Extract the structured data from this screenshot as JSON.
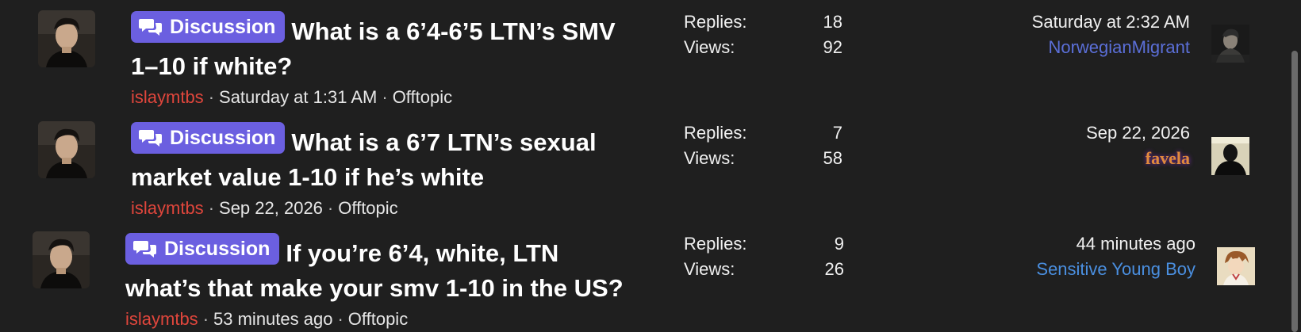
{
  "threads": [
    {
      "prefix": "Discussion",
      "title_line1": "What is a 6’4-6’5 LTN’s SMV",
      "title_line2": "1–10 if white?",
      "author": "islaymtbs",
      "started": "Saturday at 1:31 AM",
      "forum": "Offtopic",
      "replies_label": "Replies:",
      "replies": "18",
      "views_label": "Views:",
      "views": "92",
      "last_time": "Saturday at 2:32 AM",
      "last_user": "NorwegianMigrant",
      "last_user_color": "#5b6fd8",
      "last_avatar_icon": "dark-portrait-avatar"
    },
    {
      "prefix": "Discussion",
      "title_line1": "What is a 6’7 LTN’s sexual",
      "title_line2": "market value 1-10 if he’s white",
      "author": "islaymtbs",
      "started": "Sep 22, 2026",
      "forum": "Offtopic",
      "replies_label": "Replies:",
      "replies": "7",
      "views_label": "Views:",
      "views": "58",
      "last_time": "Sep 22, 2026",
      "last_user": "favela",
      "last_user_color": "#e08a3c",
      "last_avatar_icon": "silhouette-avatar"
    },
    {
      "prefix": "Discussion",
      "title_line1": "If you’re 6’4, white, LTN",
      "title_line2": "what’s that make your smv 1-10 in the US?",
      "author": "islaymtbs",
      "started": "53 minutes ago",
      "forum": "Offtopic",
      "replies_label": "Replies:",
      "replies": "9",
      "views_label": "Views:",
      "views": "26",
      "last_time": "44 minutes ago",
      "last_user": "Sensitive Young Boy",
      "last_user_color": "#4a8fe0",
      "last_avatar_icon": "anime-character-avatar"
    }
  ],
  "colors": {
    "background": "#1f1f1f",
    "badge": "#6b5fe0",
    "author": "#e0463c"
  }
}
